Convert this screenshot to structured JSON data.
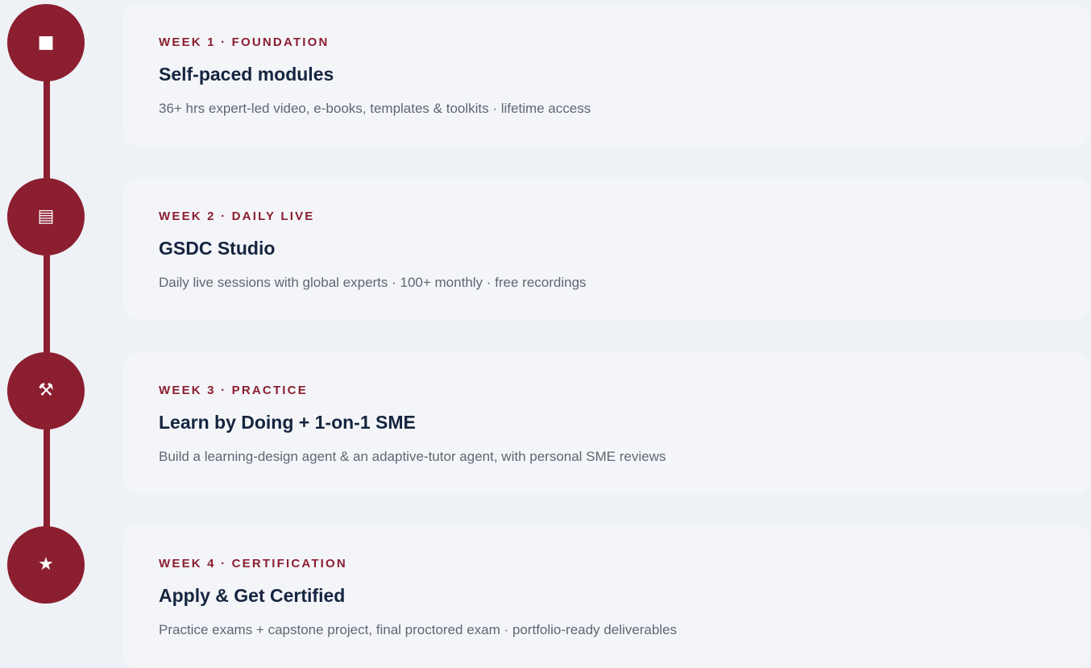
{
  "steps": [
    {
      "icon": "stop-square-icon",
      "glyph": "■",
      "eyebrow": "WEEK 1 · FOUNDATION",
      "title": "Self-paced modules",
      "description": "36+ hrs expert-led video, e-books, templates & toolkits · lifetime access"
    },
    {
      "icon": "document-lines-icon",
      "glyph": "▤",
      "eyebrow": "WEEK 2 · DAILY LIVE",
      "title": "GSDC Studio",
      "description": "Daily live sessions with global experts · 100+ monthly · free recordings"
    },
    {
      "icon": "hammer-pick-icon",
      "glyph": "⚒",
      "eyebrow": "WEEK 3 · PRACTICE",
      "title": "Learn by Doing + 1-on-1 SME",
      "description": "Build a learning-design agent & an adaptive-tutor agent, with personal SME reviews"
    },
    {
      "icon": "star-icon",
      "glyph": "★",
      "eyebrow": "WEEK 4 · CERTIFICATION",
      "title": "Apply & Get Certified",
      "description": "Practice exams + capstone project, final proctored exam · portfolio-ready deliverables"
    }
  ],
  "colors": {
    "accent": "#8b1e2f",
    "title": "#15253f",
    "text": "#5f6673",
    "card": "#f4f5f9",
    "background": "#eef1f5"
  }
}
